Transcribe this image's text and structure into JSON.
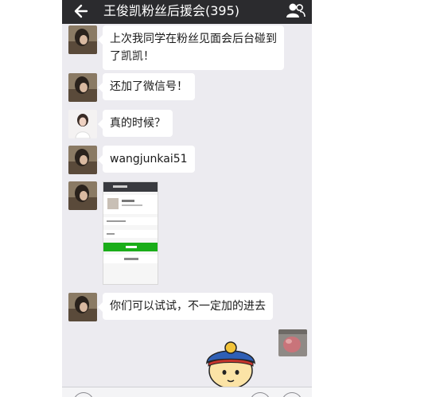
{
  "header": {
    "title": "王俊凯粉丝后援会(395)",
    "back_icon": "back-arrow-icon",
    "members_icon": "group-members-icon"
  },
  "colors": {
    "titlebar": "#2b2b2e",
    "background": "#ecebf0",
    "bubble": "#ffffff",
    "green_button": "#1aad19"
  },
  "messages": [
    {
      "sender": "other",
      "lines": [
        "上次我同学在粉丝见面会后台碰到",
        "了凯凯！"
      ]
    },
    {
      "sender": "other",
      "lines": [
        "还加了微信号！"
      ]
    },
    {
      "sender": "other-2",
      "lines": [
        "真的时候？"
      ]
    },
    {
      "sender": "other",
      "lines": [
        "wangjunkai51"
      ]
    },
    {
      "sender": "other",
      "type": "image",
      "content": "wechat-add-friend-screenshot"
    },
    {
      "sender": "other",
      "lines": [
        "你们可以试试，不一定加的进去"
      ]
    },
    {
      "sender": "self",
      "type": "image",
      "content": "avatar-photo"
    },
    {
      "sender": "other",
      "type": "sticker",
      "content": "cartoon-sticker"
    }
  ],
  "input_bar": {
    "voice_icon": "voice-icon",
    "emoji_icon": "emoji-icon",
    "plus_icon": "plus-icon"
  }
}
